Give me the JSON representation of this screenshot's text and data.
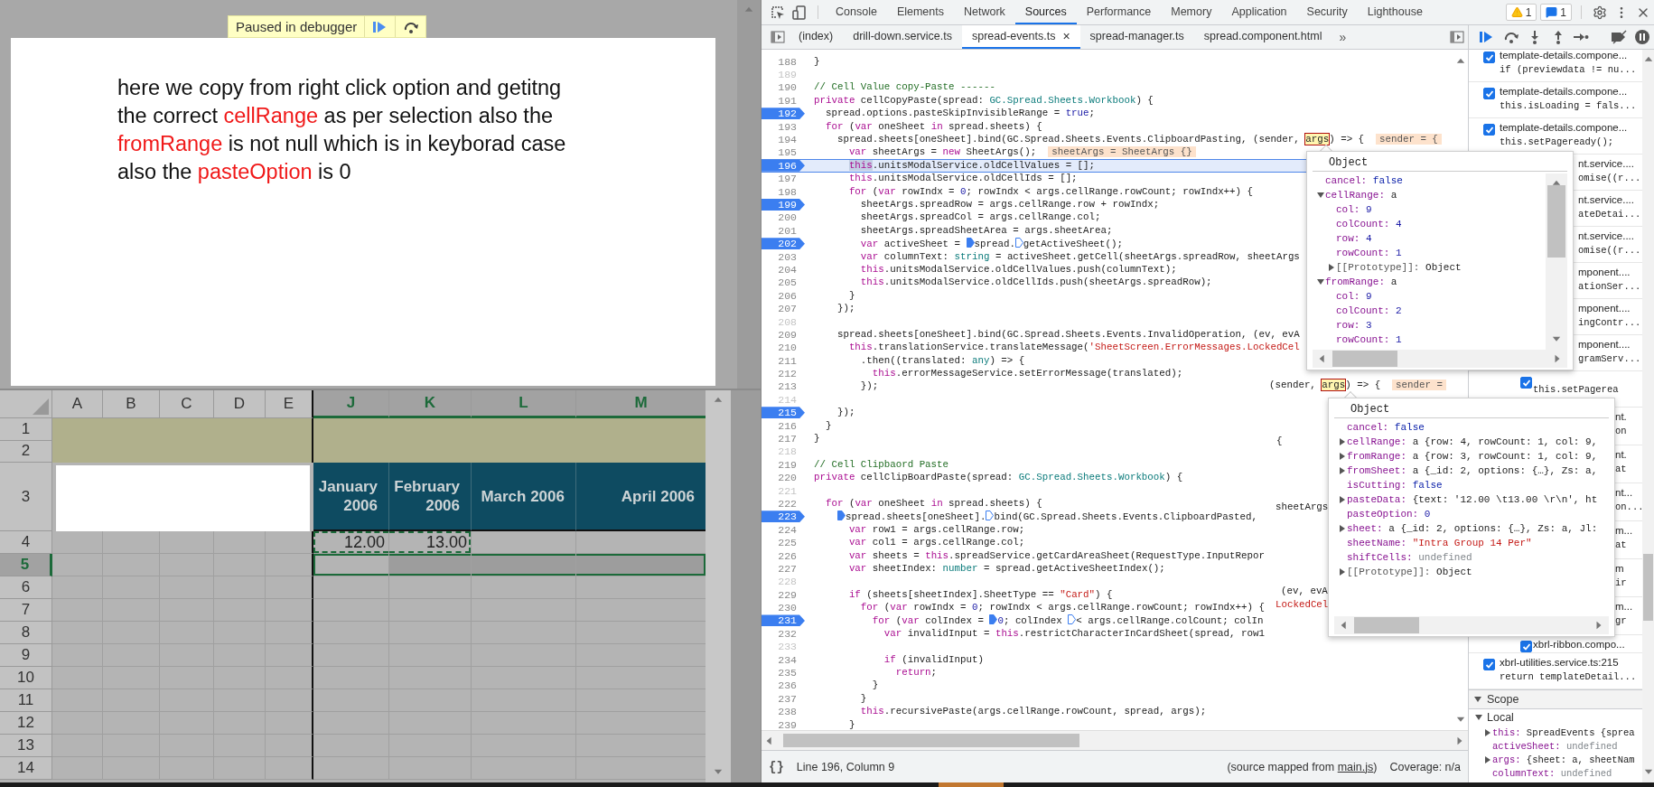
{
  "debugger_banner": {
    "text": "Paused in debugger"
  },
  "note": {
    "segments": [
      {
        "text": "here we copy from right click option and getitng the correct ",
        "highlighted": false
      },
      {
        "text": "cellRange",
        "highlighted": true
      },
      {
        "text": " as per selection also the ",
        "highlighted": false
      },
      {
        "text": "fromRange",
        "highlighted": true
      },
      {
        "text": " is not null which is in keyborad case also the ",
        "highlighted": false
      },
      {
        "text": "pasteOption",
        "highlighted": true
      },
      {
        "text": " is 0",
        "highlighted": false
      }
    ]
  },
  "spreadsheet": {
    "columns": [
      {
        "label": "A",
        "selected": false
      },
      {
        "label": "B",
        "selected": false
      },
      {
        "label": "C",
        "selected": false
      },
      {
        "label": "D",
        "selected": false
      },
      {
        "label": "E",
        "selected": false
      },
      {
        "label": "J",
        "selected": true,
        "heading": "January 2006",
        "value": "12.00",
        "copied": true
      },
      {
        "label": "K",
        "selected": true,
        "heading": "February 2006",
        "value": "13.00",
        "copied": true
      },
      {
        "label": "L",
        "selected": true,
        "heading": "March 2006"
      },
      {
        "label": "M",
        "selected": true,
        "heading": "April 2006"
      }
    ],
    "rows": [
      {
        "label": "1",
        "kind": "band",
        "selected": false
      },
      {
        "label": "2",
        "kind": "band",
        "selected": false
      },
      {
        "label": "3",
        "kind": "heading",
        "selected": false
      },
      {
        "label": "4",
        "kind": "values",
        "selected": false
      },
      {
        "label": "5",
        "kind": "plain",
        "selected": true
      },
      {
        "label": "6",
        "kind": "plain",
        "selected": false
      },
      {
        "label": "7",
        "kind": "plain",
        "selected": false
      },
      {
        "label": "8",
        "kind": "plain",
        "selected": false
      },
      {
        "label": "9",
        "kind": "plain",
        "selected": false
      },
      {
        "label": "10",
        "kind": "plain",
        "selected": false
      },
      {
        "label": "11",
        "kind": "plain",
        "selected": false
      },
      {
        "label": "12",
        "kind": "plain",
        "selected": false
      },
      {
        "label": "13",
        "kind": "plain",
        "selected": false
      },
      {
        "label": "14",
        "kind": "plain",
        "selected": false
      }
    ]
  },
  "devtools": {
    "tabs": [
      {
        "label": "Console",
        "selected": false
      },
      {
        "label": "Elements",
        "selected": false
      },
      {
        "label": "Network",
        "selected": false
      },
      {
        "label": "Sources",
        "selected": true
      },
      {
        "label": "Performance",
        "selected": false
      },
      {
        "label": "Memory",
        "selected": false
      },
      {
        "label": "Application",
        "selected": false
      },
      {
        "label": "Security",
        "selected": false
      },
      {
        "label": "Lighthouse",
        "selected": false
      }
    ],
    "warnings": "1",
    "messages": "1",
    "files": [
      {
        "label": "(index)",
        "selected": false
      },
      {
        "label": "drill-down.service.ts",
        "selected": false
      },
      {
        "label": "spread-events.ts",
        "selected": true,
        "close": "×"
      },
      {
        "label": "spread-manager.ts",
        "selected": false
      },
      {
        "label": "spread.component.html",
        "selected": false
      }
    ],
    "more_tabs": "»",
    "code": {
      "lines": [
        {
          "number": "188",
          "breakpoint": false,
          "current": false,
          "segments": [
            {
              "kind": "plain",
              "text": "}"
            }
          ]
        },
        {
          "number": "189",
          "breakpoint": false,
          "current": false
        },
        {
          "number": "190",
          "breakpoint": false,
          "current": false,
          "segments": [
            {
              "kind": "comment",
              "text": "// Cell Value copy-Paste ------"
            }
          ]
        },
        {
          "number": "191",
          "breakpoint": false,
          "current": false,
          "segments": [
            {
              "kind": "keyword",
              "text": "private"
            },
            {
              "kind": "plain",
              "text": " cellCopyPaste(spread: "
            },
            {
              "kind": "type",
              "text": "GC.Spread.Sheets.Workbook"
            },
            {
              "kind": "plain",
              "text": ") {"
            }
          ]
        },
        {
          "number": "192",
          "breakpoint": true,
          "current": false,
          "segments": [
            {
              "kind": "plain",
              "text": "  spread.options.pasteSkipInvisibleRange = "
            },
            {
              "kind": "literal",
              "text": "true"
            },
            {
              "kind": "plain",
              "text": ";"
            }
          ]
        },
        {
          "number": "193",
          "breakpoint": false,
          "current": false,
          "segments": [
            {
              "kind": "keyword",
              "text": "  for"
            },
            {
              "kind": "plain",
              "text": " ("
            },
            {
              "kind": "keyword",
              "text": "var"
            },
            {
              "kind": "plain",
              "text": " oneSheet "
            },
            {
              "kind": "keyword",
              "text": "in"
            },
            {
              "kind": "plain",
              "text": " spread.sheets) {"
            }
          ]
        },
        {
          "number": "194",
          "breakpoint": false,
          "current": false,
          "segments": [
            {
              "kind": "plain",
              "text": "    spread.sheets[oneSheet].bind(GC.Spread.Sheets.Events.ClipboardPasting, (sender, "
            },
            {
              "kind": "hover",
              "text": "args"
            },
            {
              "kind": "plain",
              "text": ") => {  "
            },
            {
              "kind": "inline-value",
              "text": "sender = {"
            }
          ]
        },
        {
          "number": "195",
          "breakpoint": false,
          "current": false,
          "segments": [
            {
              "kind": "keyword",
              "text": "      var"
            },
            {
              "kind": "plain",
              "text": " sheetArgs = "
            },
            {
              "kind": "keyword",
              "text": "new"
            },
            {
              "kind": "plain",
              "text": " SheetArgs();  "
            },
            {
              "kind": "inline-value",
              "text": "sheetArgs = SheetArgs {}"
            }
          ]
        },
        {
          "number": "196",
          "breakpoint": true,
          "current": true,
          "segments": [
            {
              "kind": "keyword-selected",
              "text": "      this"
            },
            {
              "kind": "plain",
              "text": ".unitsModalService.oldCellValues = [];"
            }
          ]
        },
        {
          "number": "197",
          "breakpoint": false,
          "current": false,
          "segments": [
            {
              "kind": "keyword",
              "text": "      this"
            },
            {
              "kind": "plain",
              "text": ".unitsModalService.oldCellIds = [];"
            }
          ]
        },
        {
          "number": "198",
          "breakpoint": false,
          "current": false,
          "segments": [
            {
              "kind": "keyword",
              "text": "      for"
            },
            {
              "kind": "plain",
              "text": " ("
            },
            {
              "kind": "keyword",
              "text": "var"
            },
            {
              "kind": "plain",
              "text": " rowIndx = "
            },
            {
              "kind": "literal",
              "text": "0"
            },
            {
              "kind": "plain",
              "text": "; rowIndx < args.cellRange.rowCount; rowIndx++) {"
            }
          ]
        },
        {
          "number": "199",
          "breakpoint": true,
          "current": false,
          "segments": [
            {
              "kind": "plain",
              "text": "        sheetArgs.spreadRow = args.cellRange.row + rowIndx;"
            }
          ]
        },
        {
          "number": "200",
          "breakpoint": false,
          "current": false,
          "segments": [
            {
              "kind": "plain",
              "text": "        sheetArgs.spreadCol = args.cellRange.col;"
            }
          ]
        },
        {
          "number": "201",
          "breakpoint": false,
          "current": false,
          "segments": [
            {
              "kind": "plain",
              "text": "        sheetArgs.spreadSheetArea = args.sheetArea;"
            }
          ]
        },
        {
          "number": "202",
          "breakpoint": true,
          "current": false,
          "segments": [
            {
              "kind": "keyword",
              "text": "        var"
            },
            {
              "kind": "plain",
              "text": " activeSheet = "
            },
            {
              "kind": "plain",
              "text": "spread.",
              "marker": true
            },
            {
              "kind": "plain",
              "text": "getActiveSheet();",
              "marker": false
            }
          ]
        },
        {
          "number": "203",
          "breakpoint": false,
          "current": false,
          "segments": [
            {
              "kind": "keyword",
              "text": "        var"
            },
            {
              "kind": "plain",
              "text": " columnText: "
            },
            {
              "kind": "type",
              "text": "string"
            },
            {
              "kind": "plain",
              "text": " = activeSheet.getCell(sheetArgs.spreadRow, sheetArgs"
            }
          ]
        },
        {
          "number": "204",
          "breakpoint": false,
          "current": false,
          "segments": [
            {
              "kind": "keyword",
              "text": "        this"
            },
            {
              "kind": "plain",
              "text": ".unitsModalService.oldCellValues.push(columnText);"
            }
          ]
        },
        {
          "number": "205",
          "breakpoint": false,
          "current": false,
          "segments": [
            {
              "kind": "keyword",
              "text": "        this"
            },
            {
              "kind": "plain",
              "text": ".unitsModalService.oldCellIds.push(sheetArgs.spreadRow);"
            }
          ]
        },
        {
          "number": "206",
          "breakpoint": false,
          "current": false,
          "segments": [
            {
              "kind": "plain",
              "text": "      }"
            }
          ]
        },
        {
          "number": "207",
          "breakpoint": false,
          "current": false,
          "segments": [
            {
              "kind": "plain",
              "text": "    });"
            }
          ]
        },
        {
          "number": "208",
          "breakpoint": false,
          "current": false
        },
        {
          "number": "209",
          "breakpoint": false,
          "current": false,
          "segments": [
            {
              "kind": "plain",
              "text": "    spread.sheets[oneSheet].bind(GC.Spread.Sheets.Events.InvalidOperation, (ev, evA"
            }
          ]
        },
        {
          "number": "210",
          "breakpoint": false,
          "current": false,
          "segments": [
            {
              "kind": "keyword",
              "text": "      this"
            },
            {
              "kind": "plain",
              "text": ".translationService.translateMessage("
            },
            {
              "kind": "string",
              "text": "'SheetScreen.ErrorMessages.LockedCel"
            }
          ]
        },
        {
          "number": "211",
          "breakpoint": false,
          "current": false,
          "segments": [
            {
              "kind": "plain",
              "text": "        .then((translated: "
            },
            {
              "kind": "type",
              "text": "any"
            },
            {
              "kind": "plain",
              "text": ") => {"
            }
          ]
        },
        {
          "number": "212",
          "breakpoint": false,
          "current": false,
          "segments": [
            {
              "kind": "keyword",
              "text": "          this"
            },
            {
              "kind": "plain",
              "text": ".errorMessageService.setErrorMessage(translated);"
            }
          ]
        },
        {
          "number": "213",
          "breakpoint": false,
          "current": false,
          "segments": [
            {
              "kind": "plain",
              "text": "        });"
            }
          ]
        },
        {
          "number": "214",
          "breakpoint": false,
          "current": false
        },
        {
          "number": "215",
          "breakpoint": true,
          "current": false,
          "segments": [
            {
              "kind": "plain",
              "text": "    });"
            }
          ]
        },
        {
          "number": "216",
          "breakpoint": false,
          "current": false,
          "segments": [
            {
              "kind": "plain",
              "text": "  }"
            }
          ]
        },
        {
          "number": "217",
          "breakpoint": false,
          "current": false,
          "segments": [
            {
              "kind": "plain",
              "text": "}"
            }
          ]
        },
        {
          "number": "218",
          "breakpoint": false,
          "current": false
        },
        {
          "number": "219",
          "breakpoint": false,
          "current": false,
          "segments": [
            {
              "kind": "comment",
              "text": "// Cell Clipbaord Paste"
            }
          ]
        },
        {
          "number": "220",
          "breakpoint": false,
          "current": false,
          "segments": [
            {
              "kind": "keyword",
              "text": "private"
            },
            {
              "kind": "plain",
              "text": " cellClipBoardPaste(spread: "
            },
            {
              "kind": "type",
              "text": "GC.Spread.Sheets.Workbook"
            },
            {
              "kind": "plain",
              "text": ") {"
            }
          ]
        },
        {
          "number": "221",
          "breakpoint": false,
          "current": false
        },
        {
          "number": "222",
          "breakpoint": false,
          "current": false,
          "segments": [
            {
              "kind": "keyword",
              "text": "  for"
            },
            {
              "kind": "plain",
              "text": " ("
            },
            {
              "kind": "keyword",
              "text": "var"
            },
            {
              "kind": "plain",
              "text": " oneSheet "
            },
            {
              "kind": "keyword",
              "text": "in"
            },
            {
              "kind": "plain",
              "text": " spread.sheets) {"
            }
          ]
        },
        {
          "number": "223",
          "breakpoint": true,
          "current": false,
          "segments": [
            {
              "kind": "plain",
              "text": "    spread.sheets[oneSheet].",
              "marker": true
            },
            {
              "kind": "plain",
              "text": "bind(GC.Spread.Sheets.Events.ClipboardPasted,",
              "marker": false
            }
          ]
        },
        {
          "number": "224",
          "breakpoint": false,
          "current": false,
          "segments": [
            {
              "kind": "keyword",
              "text": "      var"
            },
            {
              "kind": "plain",
              "text": " row1 = args.cellRange.row;"
            }
          ]
        },
        {
          "number": "225",
          "breakpoint": false,
          "current": false,
          "segments": [
            {
              "kind": "keyword",
              "text": "      var"
            },
            {
              "kind": "plain",
              "text": " col1 = args.cellRange.col;"
            }
          ]
        },
        {
          "number": "226",
          "breakpoint": false,
          "current": false,
          "segments": [
            {
              "kind": "keyword",
              "text": "      var"
            },
            {
              "kind": "plain",
              "text": " sheets = "
            },
            {
              "kind": "keyword",
              "text": "this"
            },
            {
              "kind": "plain",
              "text": ".spreadService.getCardAreaSheet(RequestType.InputRepor"
            }
          ]
        },
        {
          "number": "227",
          "breakpoint": false,
          "current": false,
          "segments": [
            {
              "kind": "keyword",
              "text": "      var"
            },
            {
              "kind": "plain",
              "text": " sheetIndex: "
            },
            {
              "kind": "type",
              "text": "number"
            },
            {
              "kind": "plain",
              "text": " = spread.getActiveSheetIndex();"
            }
          ]
        },
        {
          "number": "228",
          "breakpoint": false,
          "current": false
        },
        {
          "number": "229",
          "breakpoint": false,
          "current": false,
          "segments": [
            {
              "kind": "keyword",
              "text": "      if"
            },
            {
              "kind": "plain",
              "text": " (sheets[sheetIndex].SheetType == "
            },
            {
              "kind": "string",
              "text": "\"Card\""
            },
            {
              "kind": "plain",
              "text": ") {"
            }
          ]
        },
        {
          "number": "230",
          "breakpoint": false,
          "current": false,
          "segments": [
            {
              "kind": "keyword",
              "text": "        for"
            },
            {
              "kind": "plain",
              "text": " ("
            },
            {
              "kind": "keyword",
              "text": "var"
            },
            {
              "kind": "plain",
              "text": " rowIndx = "
            },
            {
              "kind": "literal",
              "text": "0"
            },
            {
              "kind": "plain",
              "text": "; rowIndx < args.cellRange.rowCount; rowIndx++) {"
            }
          ]
        },
        {
          "number": "231",
          "breakpoint": true,
          "current": false,
          "segments": [
            {
              "kind": "keyword",
              "text": "          for"
            },
            {
              "kind": "plain",
              "text": " ("
            },
            {
              "kind": "keyword",
              "text": "var"
            },
            {
              "kind": "plain",
              "text": " colIndex = "
            },
            {
              "kind": "literal",
              "text": "0",
              "marker": true
            },
            {
              "kind": "plain",
              "text": "; colIndex"
            },
            {
              "kind": "plain",
              "text": " < args.cellRange.colCount; colIn",
              "marker": false
            }
          ]
        },
        {
          "number": "232",
          "breakpoint": false,
          "current": false,
          "segments": [
            {
              "kind": "keyword",
              "text": "            var"
            },
            {
              "kind": "plain",
              "text": " invalidInput = "
            },
            {
              "kind": "keyword",
              "text": "this"
            },
            {
              "kind": "plain",
              "text": ".restrictCharacterInCardSheet(spread, row1"
            }
          ]
        },
        {
          "number": "233",
          "breakpoint": false,
          "current": false
        },
        {
          "number": "234",
          "breakpoint": false,
          "current": false,
          "segments": [
            {
              "kind": "keyword",
              "text": "            if"
            },
            {
              "kind": "plain",
              "text": " (invalidInput)"
            }
          ]
        },
        {
          "number": "235",
          "breakpoint": false,
          "current": false,
          "segments": [
            {
              "kind": "keyword",
              "text": "              return"
            },
            {
              "kind": "plain",
              "text": ";"
            }
          ]
        },
        {
          "number": "236",
          "breakpoint": false,
          "current": false,
          "segments": [
            {
              "kind": "plain",
              "text": "          }"
            }
          ]
        },
        {
          "number": "237",
          "breakpoint": false,
          "current": false,
          "segments": [
            {
              "kind": "plain",
              "text": "        }"
            }
          ]
        },
        {
          "number": "238",
          "breakpoint": false,
          "current": false,
          "segments": [
            {
              "kind": "keyword",
              "text": "        this"
            },
            {
              "kind": "plain",
              "text": ".recursivePaste(args.cellRange.rowCount, spread, args);"
            }
          ]
        },
        {
          "number": "239",
          "breakpoint": false,
          "current": false,
          "segments": [
            {
              "kind": "plain",
              "text": "      }"
            }
          ]
        }
      ],
      "ghosts": [
        {
          "segments": [
            {
              "kind": "plain",
              "text": "(sender, "
            },
            {
              "kind": "hover",
              "text": "args"
            },
            {
              "kind": "plain",
              "text": ") => {  "
            },
            {
              "kind": "inline-value",
              "text": "sender ="
            }
          ]
        },
        {
          "segments": [
            {
              "kind": "plain",
              "text": "{"
            }
          ]
        },
        {
          "segments": [
            {
              "kind": "plain",
              "text": "sheetArgs"
            }
          ]
        },
        {
          "segments": [
            {
              "kind": "plain",
              "text": "(ev, evA"
            }
          ]
        },
        {
          "segments": [
            {
              "kind": "string",
              "text": "LockedCel"
            }
          ]
        }
      ]
    },
    "status": {
      "pretty_print": "{}",
      "position": "Line 196, Column 9",
      "source_prefix": "(source mapped from ",
      "source_link": "main.js",
      "source_suffix": ")",
      "coverage": "Coverage: n/a"
    },
    "breakpoints": [
      {
        "kind": "full",
        "checked": true,
        "file": "template-details.compone...",
        "code": "if (previewdata != nu..."
      },
      {
        "kind": "full",
        "checked": true,
        "file": "template-details.compone...",
        "code": "this.isLoading = fals..."
      },
      {
        "kind": "full",
        "checked": true,
        "file": "template-details.compone...",
        "code": "this.setPageready();"
      },
      {
        "kind": "partial",
        "file": "nt.service....",
        "code": "omise((r..."
      },
      {
        "kind": "partial",
        "file": "nt.service....",
        "code": "ateDetai..."
      },
      {
        "kind": "partial",
        "file": "nt.service....",
        "code": "omise((r..."
      },
      {
        "kind": "partial",
        "file": "mponent....",
        "code": "ationSer..."
      },
      {
        "kind": "partial",
        "file": "mponent....",
        "code": "ingContr..."
      },
      {
        "kind": "partial",
        "file": "mponent....",
        "code": "gramServ..."
      },
      {
        "kind": "lower",
        "checked": true,
        "code": "this.setPagerea"
      },
      {
        "kind": "sliver",
        "file": "nt.",
        "code": "on"
      },
      {
        "kind": "sliver",
        "file": "nt.",
        "code": "at"
      },
      {
        "kind": "sliver",
        "file": "nt...",
        "code": "on..."
      },
      {
        "kind": "sliver",
        "file": "m...",
        "code": "at"
      },
      {
        "kind": "sliver",
        "file": "m",
        "code": "ir"
      },
      {
        "kind": "sliver",
        "file": "m...",
        "code": "gr"
      },
      {
        "kind": "shifted",
        "checked": true,
        "file": "xbrl-ribbon.compo..."
      },
      {
        "kind": "full",
        "checked": true,
        "file": "xbrl-utilities.service.ts:215",
        "code": "return templateDetail..."
      }
    ],
    "scope": {
      "title": "Scope",
      "expanded": true,
      "groups": [
        {
          "title": "Local",
          "expanded": true,
          "entries": [
            {
              "name": "this:",
              "value": "SpreadEvents {sprea",
              "kind": "object",
              "expanded": false
            },
            {
              "name": "activeSheet:",
              "value": "undefined",
              "kind": "undefined"
            },
            {
              "name": "args:",
              "value": "{sheet: a, sheetNam",
              "kind": "object",
              "expanded": false
            },
            {
              "name": "columnText:",
              "value": "undefined",
              "kind": "undefined"
            }
          ]
        }
      ]
    },
    "popovers": [
      {
        "title": "Object",
        "entries": [
          {
            "name": "cancel:",
            "value": "false",
            "kind": "boolean"
          },
          {
            "name": "cellRange:",
            "value": "a",
            "kind": "object",
            "expanded": true,
            "children": [
              {
                "name": "col:",
                "value": "9",
                "kind": "number"
              },
              {
                "name": "colCount:",
                "value": "4",
                "kind": "number"
              },
              {
                "name": "row:",
                "value": "4",
                "kind": "number"
              },
              {
                "name": "rowCount:",
                "value": "1",
                "kind": "number"
              },
              {
                "name": "[[Prototype]]:",
                "value": "Object",
                "kind": "internal",
                "expanded": false
              }
            ]
          },
          {
            "name": "fromRange:",
            "value": "a",
            "kind": "object",
            "expanded": true,
            "children": [
              {
                "name": "col:",
                "value": "9",
                "kind": "number"
              },
              {
                "name": "colCount:",
                "value": "2",
                "kind": "number"
              },
              {
                "name": "row:",
                "value": "3",
                "kind": "number"
              },
              {
                "name": "rowCount:",
                "value": "1",
                "kind": "number"
              }
            ]
          }
        ]
      },
      {
        "title": "Object",
        "entries": [
          {
            "name": "cancel:",
            "value": "false",
            "kind": "boolean"
          },
          {
            "name": "cellRange:",
            "value": "a {row: 4, rowCount: 1, col: 9,",
            "kind": "object",
            "expanded": false
          },
          {
            "name": "fromRange:",
            "value": "a {row: 3, rowCount: 1, col: 9,",
            "kind": "object",
            "expanded": false
          },
          {
            "name": "fromSheet:",
            "value": "a {_id: 2, options: {…}, Zs: a,",
            "kind": "object",
            "expanded": false
          },
          {
            "name": "isCutting:",
            "value": "false",
            "kind": "boolean"
          },
          {
            "name": "pasteData:",
            "value": "{text: '12.00 \\t13.00 \\r\\n', ht",
            "kind": "object",
            "expanded": false
          },
          {
            "name": "pasteOption:",
            "value": "0",
            "kind": "number"
          },
          {
            "name": "sheet:",
            "value": "a {_id: 2, options: {…}, Zs: a, Jl:",
            "kind": "object",
            "expanded": false
          },
          {
            "name": "sheetName:",
            "value": "\"Intra Group 14 Per\"",
            "kind": "string"
          },
          {
            "name": "shiftCells:",
            "value": "undefined",
            "kind": "undefined"
          },
          {
            "name": "[[Prototype]]:",
            "value": "Object",
            "kind": "internal",
            "expanded": false
          }
        ]
      }
    ]
  }
}
